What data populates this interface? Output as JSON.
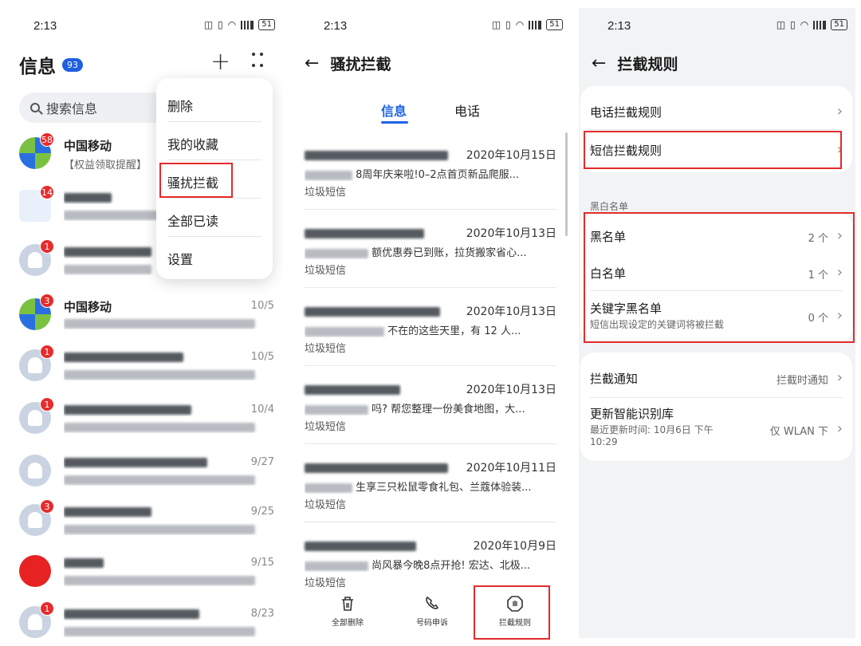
{
  "status_bar": {
    "time": "2:13",
    "battery": "51"
  },
  "panel1": {
    "title": "信息",
    "unread_badge": "93",
    "search_placeholder": "搜索信息",
    "menu": [
      "删除",
      "我的收藏",
      "骚扰拦截",
      "全部已读",
      "设置"
    ],
    "conversations": [
      {
        "name": "中国移动",
        "preview": "【权益领取提醒】",
        "date": "",
        "badge": "58",
        "avatar": "cm"
      },
      {
        "name": "",
        "preview": "",
        "date": "",
        "badge": "14",
        "avatar": "mail"
      },
      {
        "name": "",
        "preview": "",
        "date": "",
        "badge": "1",
        "avatar": "bell"
      },
      {
        "name": "中国移动",
        "preview": "",
        "date": "10/5",
        "badge": "3",
        "avatar": "cm"
      },
      {
        "name": "",
        "preview": "",
        "date": "10/5",
        "badge": "1",
        "avatar": "bell"
      },
      {
        "name": "",
        "preview": "",
        "date": "10/4",
        "badge": "1",
        "avatar": "bell"
      },
      {
        "name": "",
        "preview": "",
        "date": "9/27",
        "badge": "",
        "avatar": "bell"
      },
      {
        "name": "",
        "preview": "",
        "date": "9/25",
        "badge": "3",
        "avatar": "bell"
      },
      {
        "name": "",
        "preview": "",
        "date": "9/15",
        "badge": "",
        "avatar": "red"
      },
      {
        "name": "",
        "preview": "",
        "date": "8/23",
        "badge": "1",
        "avatar": "bell"
      }
    ]
  },
  "panel2": {
    "title": "骚扰拦截",
    "tabs": [
      "信息",
      "电话"
    ],
    "messages": [
      {
        "date": "2020年10月15日",
        "body": "8周年庆来啦!0–2点首页新品爬服...",
        "tag": "垃圾短信"
      },
      {
        "date": "2020年10月13日",
        "body": "额优惠券已到账，拉货搬家省心...",
        "tag": "垃圾短信"
      },
      {
        "date": "2020年10月13日",
        "body": "不在的这些天里，有 12 人...",
        "tag": "垃圾短信"
      },
      {
        "date": "2020年10月13日",
        "body": "吗? 帮您整理一份美食地图，大...",
        "tag": "垃圾短信"
      },
      {
        "date": "2020年10月11日",
        "body": "生享三只松鼠零食礼包、兰蔻体验装...",
        "tag": "垃圾短信"
      },
      {
        "date": "2020年10月9日",
        "body": "尚风暴今晚8点开抢! 宏达、北极...",
        "tag": "垃圾短信"
      }
    ],
    "bottom": [
      "全部删除",
      "号码申诉",
      "拦截规则"
    ]
  },
  "panel3": {
    "title": "拦截规则",
    "rules": {
      "phone": "电话拦截规则",
      "sms": "短信拦截规则"
    },
    "section": "黑白名单",
    "lists": {
      "blacklist": {
        "label": "黑名单",
        "count": "2 个"
      },
      "whitelist": {
        "label": "白名单",
        "count": "1 个"
      },
      "keyword": {
        "label": "关键字黑名单",
        "sub": "短信出现设定的关键词将被拦截",
        "count": "0 个"
      }
    },
    "notify": {
      "label": "拦截通知",
      "value": "拦截时通知"
    },
    "update": {
      "label": "更新智能识别库",
      "sub": "最近更新时间: 10月6日 下午 10:29",
      "value": "仅 WLAN 下"
    }
  }
}
